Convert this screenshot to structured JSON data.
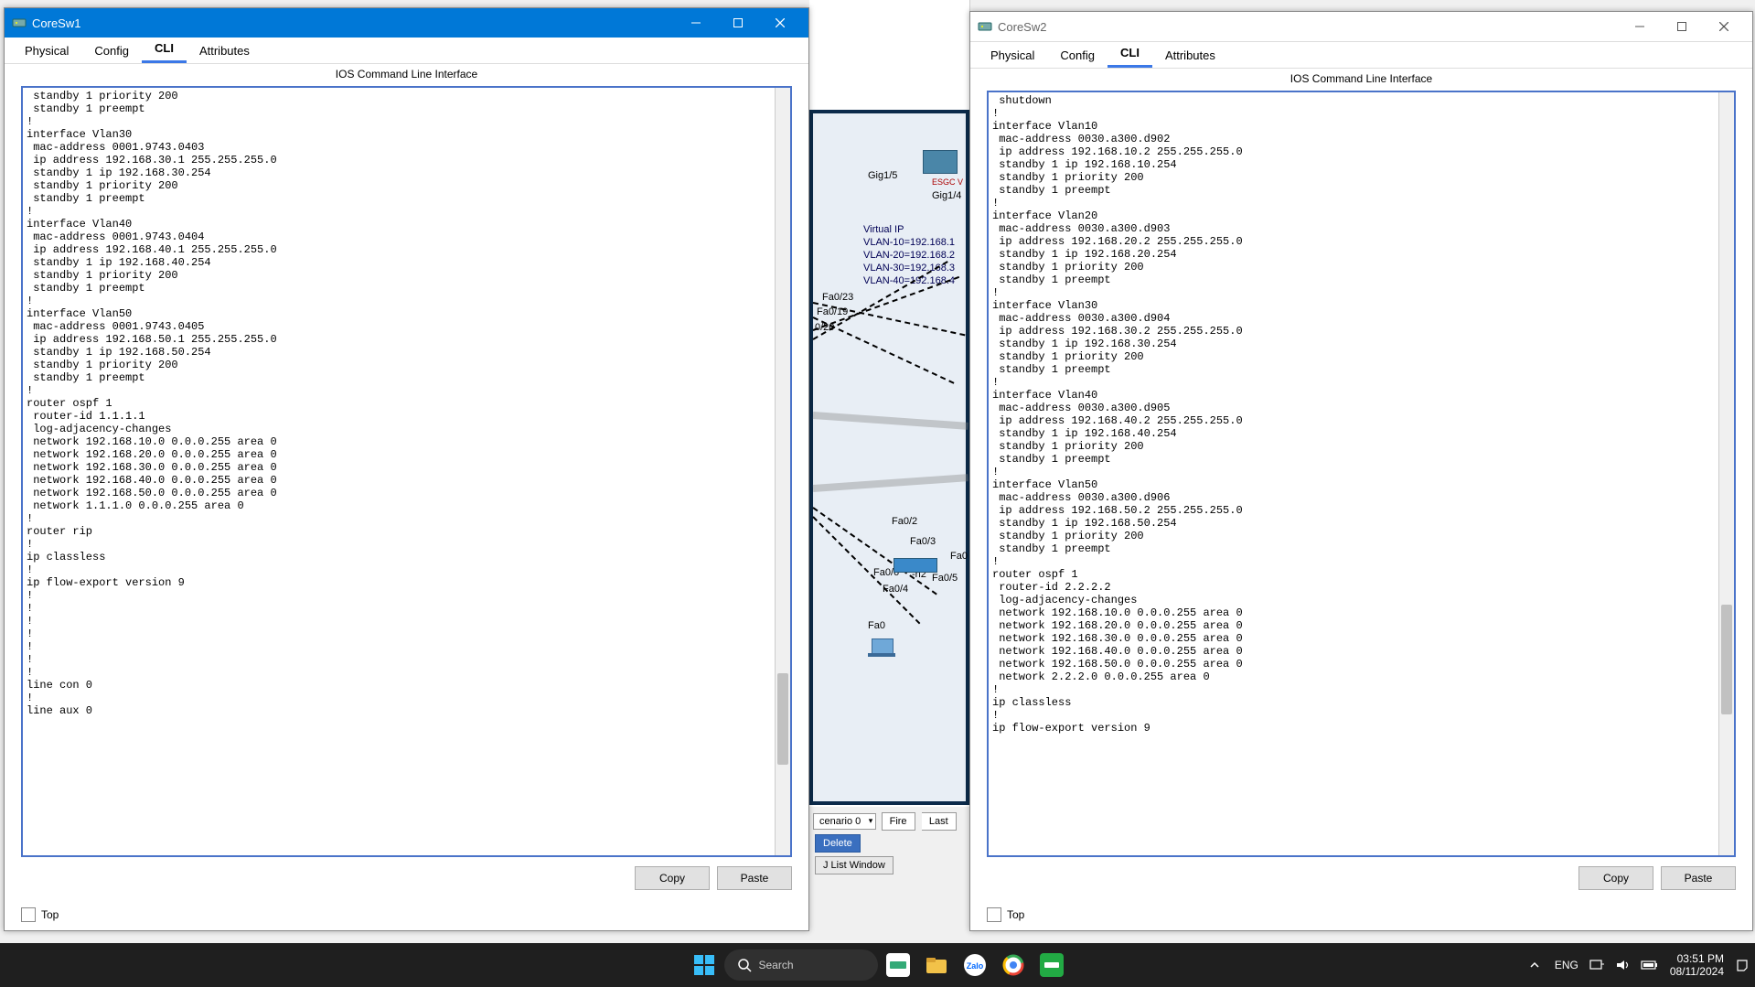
{
  "window1": {
    "title": "CoreSw1",
    "tabs": [
      "Physical",
      "Config",
      "CLI",
      "Attributes"
    ],
    "active_tab": "CLI",
    "cli_header": "IOS Command Line Interface",
    "cli_text": " standby 1 priority 200\n standby 1 preempt\n!\ninterface Vlan30\n mac-address 0001.9743.0403\n ip address 192.168.30.1 255.255.255.0\n standby 1 ip 192.168.30.254\n standby 1 priority 200\n standby 1 preempt\n!\ninterface Vlan40\n mac-address 0001.9743.0404\n ip address 192.168.40.1 255.255.255.0\n standby 1 ip 192.168.40.254\n standby 1 priority 200\n standby 1 preempt\n!\ninterface Vlan50\n mac-address 0001.9743.0405\n ip address 192.168.50.1 255.255.255.0\n standby 1 ip 192.168.50.254\n standby 1 priority 200\n standby 1 preempt\n!\nrouter ospf 1\n router-id 1.1.1.1\n log-adjacency-changes\n network 192.168.10.0 0.0.0.255 area 0\n network 192.168.20.0 0.0.0.255 area 0\n network 192.168.30.0 0.0.0.255 area 0\n network 192.168.40.0 0.0.0.255 area 0\n network 192.168.50.0 0.0.0.255 area 0\n network 1.1.1.0 0.0.0.255 area 0\n!\nrouter rip\n!\nip classless\n!\nip flow-export version 9\n!\n!\n!\n!\n!\n!\n!\nline con 0\n!\nline aux 0",
    "copy": "Copy",
    "paste": "Paste",
    "top": "Top"
  },
  "window2": {
    "title": "CoreSw2",
    "tabs": [
      "Physical",
      "Config",
      "CLI",
      "Attributes"
    ],
    "active_tab": "CLI",
    "cli_header": "IOS Command Line Interface",
    "cli_text": " shutdown\n!\ninterface Vlan10\n mac-address 0030.a300.d902\n ip address 192.168.10.2 255.255.255.0\n standby 1 ip 192.168.10.254\n standby 1 priority 200\n standby 1 preempt\n!\ninterface Vlan20\n mac-address 0030.a300.d903\n ip address 192.168.20.2 255.255.255.0\n standby 1 ip 192.168.20.254\n standby 1 priority 200\n standby 1 preempt\n!\ninterface Vlan30\n mac-address 0030.a300.d904\n ip address 192.168.30.2 255.255.255.0\n standby 1 ip 192.168.30.254\n standby 1 priority 200\n standby 1 preempt\n!\ninterface Vlan40\n mac-address 0030.a300.d905\n ip address 192.168.40.2 255.255.255.0\n standby 1 ip 192.168.40.254\n standby 1 priority 200\n standby 1 preempt\n!\ninterface Vlan50\n mac-address 0030.a300.d906\n ip address 192.168.50.2 255.255.255.0\n standby 1 ip 192.168.50.254\n standby 1 priority 200\n standby 1 preempt\n!\nrouter ospf 1\n router-id 2.2.2.2\n log-adjacency-changes\n network 192.168.10.0 0.0.0.255 area 0\n network 192.168.20.0 0.0.0.255 area 0\n network 192.168.30.0 0.0.0.255 area 0\n network 192.168.40.0 0.0.0.255 area 0\n network 192.168.50.0 0.0.0.255 area 0\n network 2.2.2.0 0.0.0.255 area 0\n!\nip classless\n!\nip flow-export version 9",
    "copy": "Copy",
    "paste": "Paste",
    "top": "Top"
  },
  "topology": {
    "virtual_ip_title": "Virtual IP",
    "virtual_ip_lines": [
      "VLAN-10=192.168.1",
      "VLAN-20=192.168.2",
      "VLAN-30=192.168.3",
      "VLAN-40=192.168.4"
    ],
    "labels": {
      "gig15": "Gig1/5",
      "gig14": "Gig1/4",
      "fa023": "Fa0/23",
      "fa019": "Fa0/19",
      "fa020": "0/20",
      "fa02": "Fa0/2",
      "fa03": "Fa0/3",
      "fa06": "Fa0/6",
      "fa04": "Fa0/4",
      "fa05": "Fa0/5",
      "fa0": "Fa0",
      "fa0r": "Fa0",
      "dev": "ESGC V",
      "h2": "-h2"
    },
    "bottom": {
      "scenario": "cenario 0",
      "fire": "Fire",
      "last": "Last",
      "delete": "Delete",
      "listwin": "J List Window"
    }
  },
  "taskbar": {
    "search_placeholder": "Search",
    "lang": "ENG",
    "time": "03:51 PM",
    "date": "08/11/2024"
  }
}
